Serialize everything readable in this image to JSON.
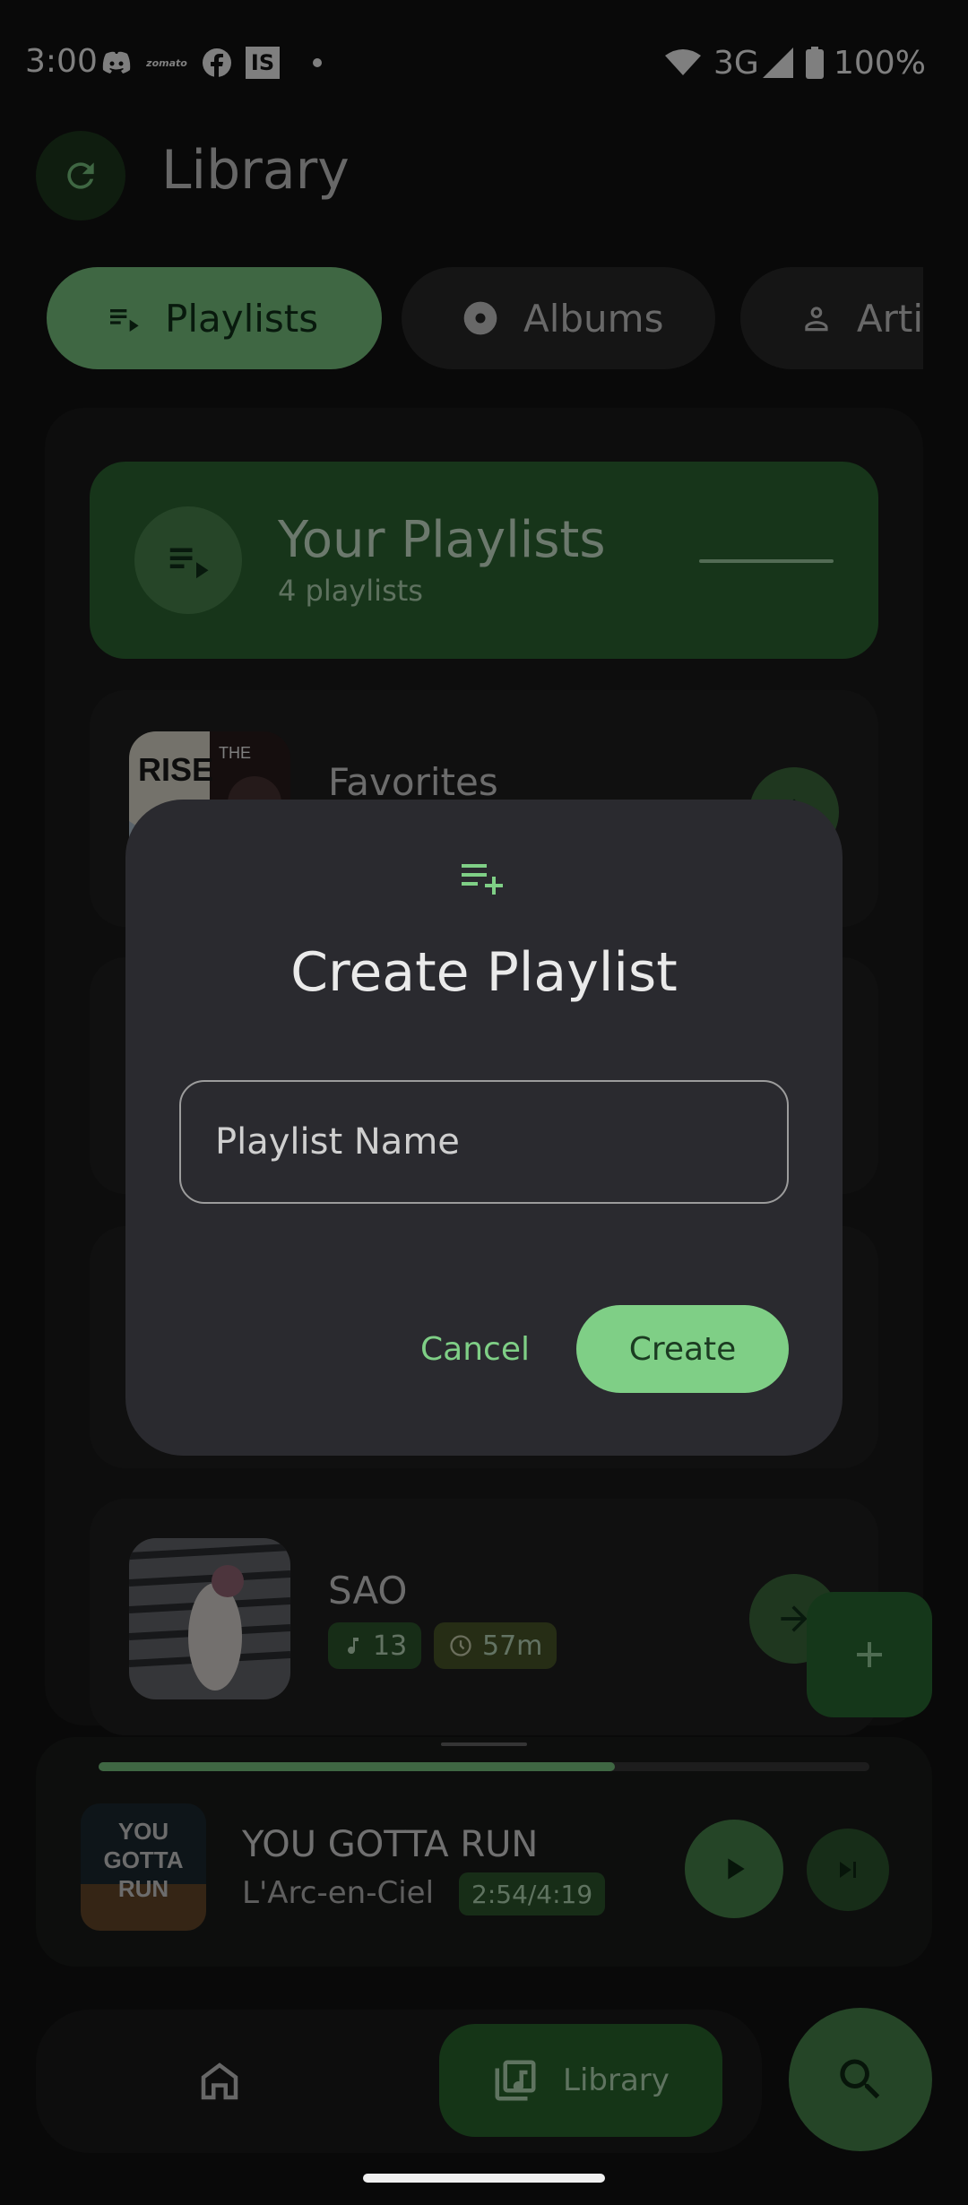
{
  "status_bar": {
    "time": "3:00",
    "network": "3G",
    "battery": "100%",
    "icons": [
      "discord-icon",
      "zomato-icon",
      "facebook-icon",
      "is-icon",
      "dot-icon",
      "wifi-icon",
      "signal-icon",
      "battery-icon"
    ]
  },
  "header": {
    "title": "Library",
    "refresh_icon": "refresh-icon"
  },
  "filters": {
    "chips": [
      {
        "label": "Playlists",
        "icon": "playlist-icon",
        "selected": true
      },
      {
        "label": "Albums",
        "icon": "album-icon",
        "selected": false
      },
      {
        "label": "Arti",
        "icon": "person-icon",
        "selected": false
      }
    ]
  },
  "playlists": {
    "banner_title": "Your Playlists",
    "banner_subtitle": "4 playlists",
    "items": [
      {
        "title": "Favorites"
      },
      {
        "title": "SAO",
        "tracks": "13",
        "duration": "57m"
      }
    ]
  },
  "now_playing": {
    "title": "YOU GOTTA RUN",
    "artist": "L'Arc-en-Ciel",
    "time": "2:54/4:19",
    "progress": 0.67
  },
  "bottom_nav": {
    "home_icon": "home-icon",
    "library_label": "Library",
    "search_icon": "search-icon"
  },
  "dialog": {
    "title": "Create Playlist",
    "field_placeholder": "Playlist Name",
    "field_value": "",
    "cancel_label": "Cancel",
    "create_label": "Create"
  },
  "colors": {
    "accent": "#7fcf86",
    "surface": "#2a2a2f",
    "background": "#121212"
  }
}
